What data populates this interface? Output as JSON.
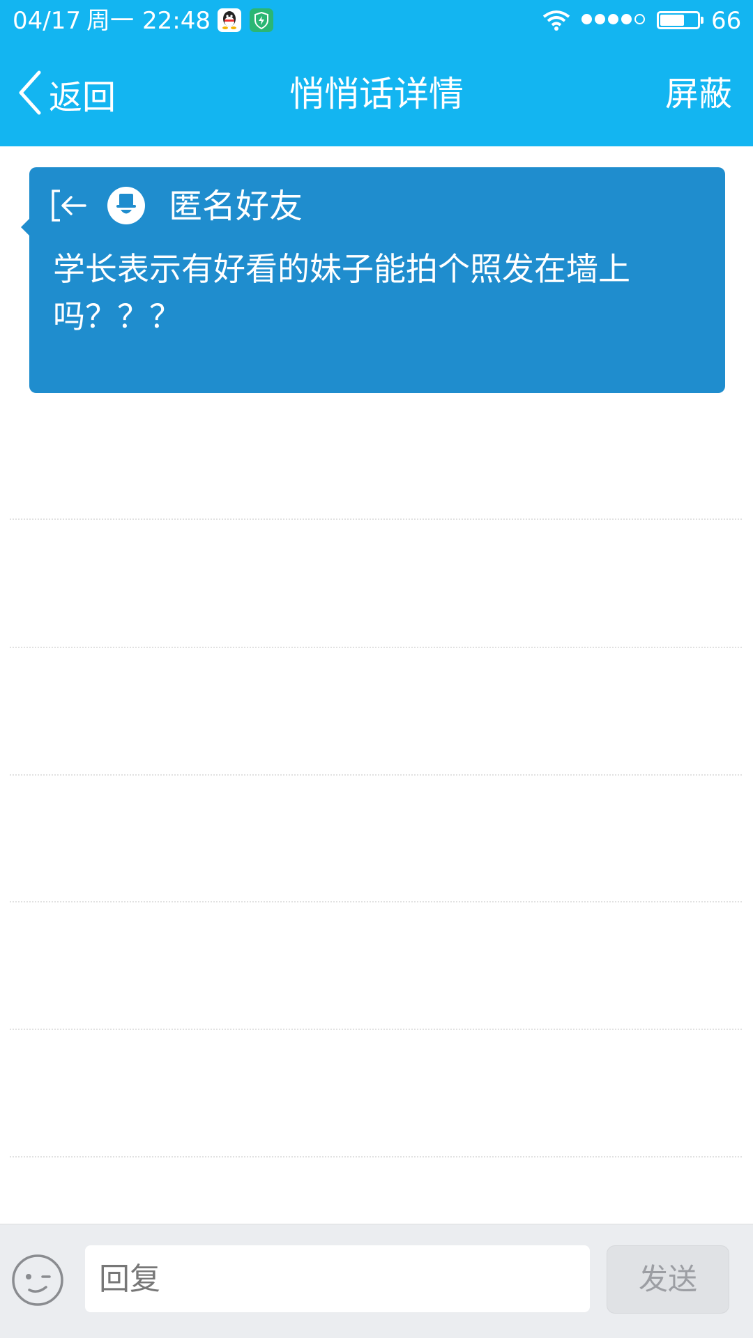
{
  "status_bar": {
    "date": "04/17",
    "weekday": "周一",
    "time": "22:48",
    "battery_level": "66",
    "battery_fraction": 0.66,
    "signal_bars": 4,
    "signal_max": 5,
    "icons": [
      "qq-icon",
      "shield-icon",
      "wifi-icon",
      "signal-icon",
      "battery-icon"
    ]
  },
  "nav": {
    "back_label": "返回",
    "title": "悄悄话详情",
    "block_label": "屏蔽"
  },
  "message": {
    "sender": "匿名好友",
    "text": "学长表示有好看的妹子能拍个照发在墙上吗？？？"
  },
  "input_bar": {
    "placeholder": "回复",
    "send_label": "发送"
  },
  "colors": {
    "header": "#13b5f1",
    "card": "#1f8dce",
    "input_bar": "#ebedf0",
    "send_disabled": "#e0e2e5"
  }
}
